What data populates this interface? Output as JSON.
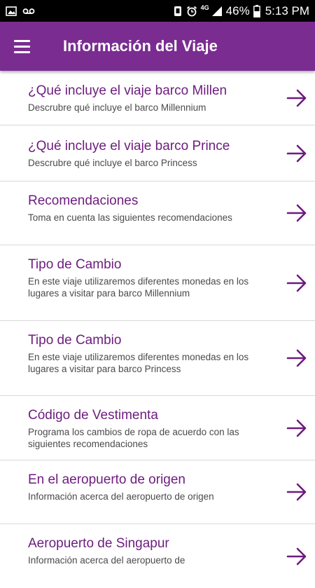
{
  "status_bar": {
    "icons_left": [
      "image-icon",
      "voicemail-icon"
    ],
    "icons_right": [
      "vibrate-icon",
      "alarm-icon",
      "signal-icon",
      "battery-icon"
    ],
    "network": "4G",
    "battery": "46%",
    "time": "5:13 PM"
  },
  "app_bar": {
    "title": "Información del Viaje",
    "menu_icon": "hamburger-menu-icon",
    "color": "#7a2c91"
  },
  "colors": {
    "accent": "#6d1c7e",
    "description": "#4a4a4a"
  },
  "items": [
    {
      "title": "¿Qué incluye el viaje barco Millen",
      "description": "Descrubre qué incluye el barco Millennium"
    },
    {
      "title": "¿Qué incluye el viaje barco Prince",
      "description": "Descrubre qué incluye el barco Princess"
    },
    {
      "title": "Recomendaciones",
      "description": "Toma en cuenta las siguientes recomendaciones"
    },
    {
      "title": "Tipo de Cambio",
      "description": "En este viaje utilizaremos diferentes monedas en los lugares a visitar para barco Millennium"
    },
    {
      "title": "Tipo de Cambio",
      "description": "En este viaje utilizaremos diferentes monedas en los lugares a visitar para barco Princess"
    },
    {
      "title": "Código de Vestimenta",
      "description": "Programa los cambios de ropa de acuerdo con las siguientes recomendaciones"
    },
    {
      "title": "En el aeropuerto de origen",
      "description": "Información acerca del aeropuerto de origen"
    },
    {
      "title": "Aeropuerto de Singapur",
      "description": "Información acerca del aeropuerto de"
    }
  ]
}
